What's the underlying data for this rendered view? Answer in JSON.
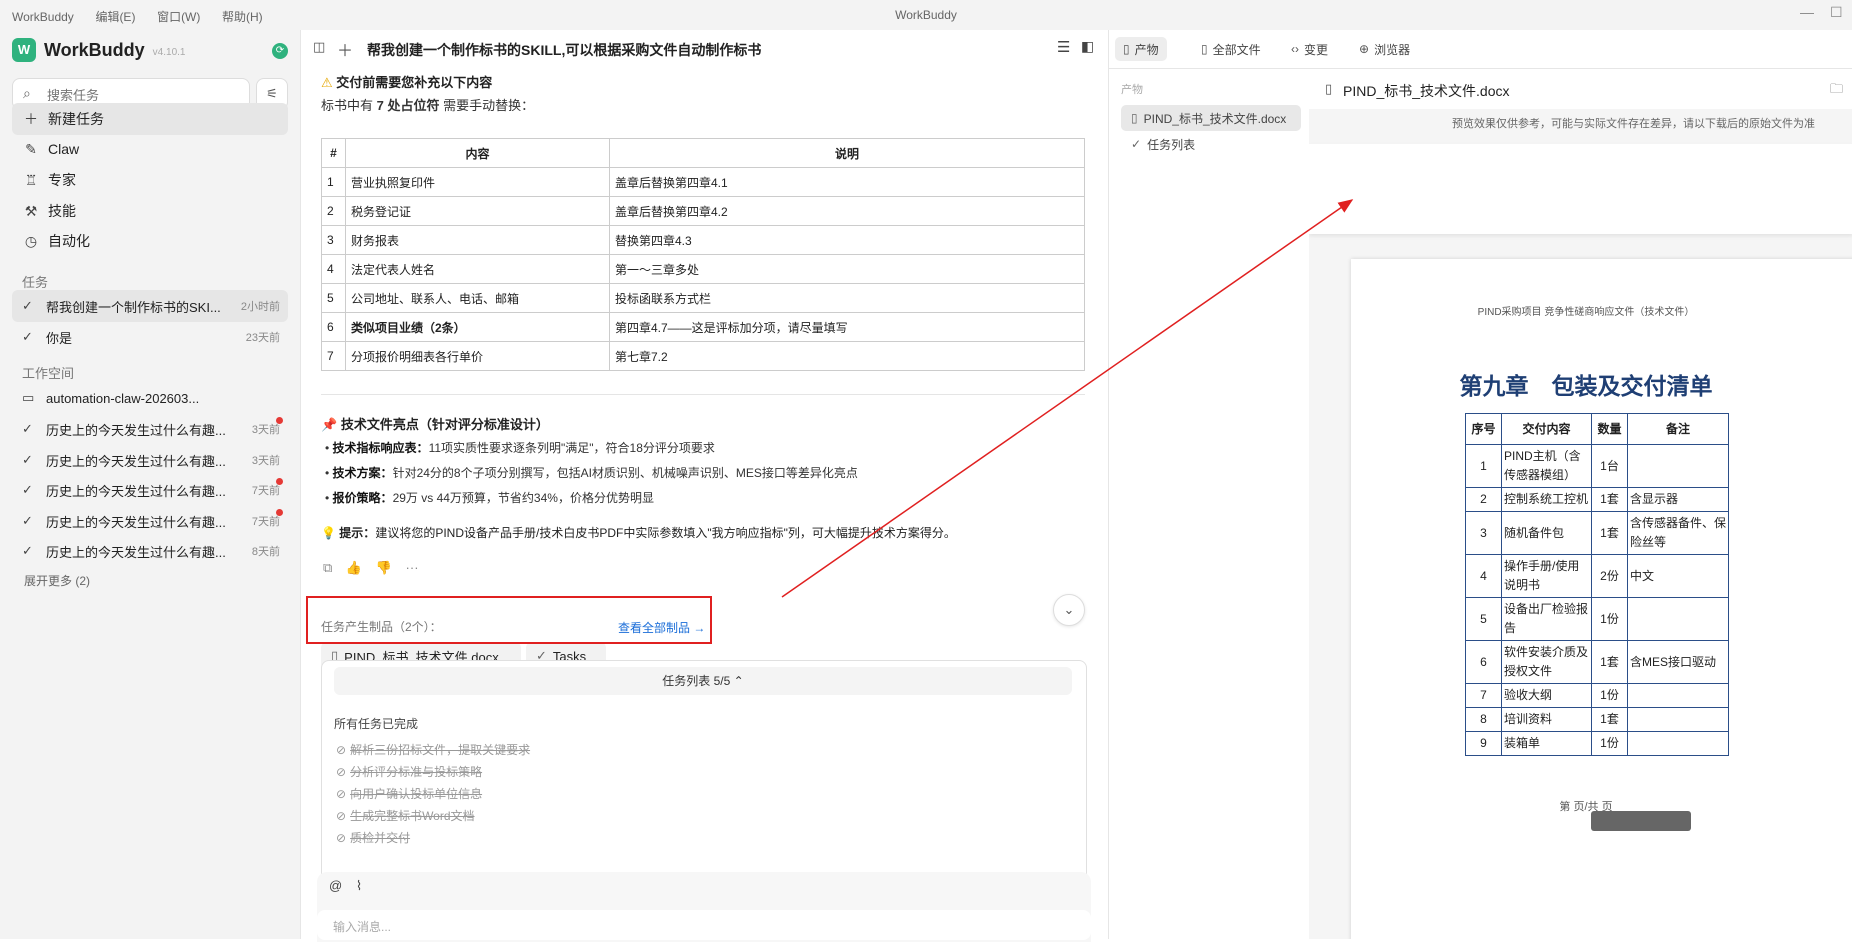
{
  "titlebar": {
    "menu": [
      "WorkBuddy",
      "编辑(E)",
      "窗口(W)",
      "帮助(H)"
    ],
    "title": "WorkBuddy",
    "minimize": "—",
    "maximize": "☐"
  },
  "sidebar": {
    "brand": {
      "name": "WorkBuddy",
      "version": "v4.10.1"
    },
    "search_placeholder": "搜索任务",
    "nav": [
      {
        "label": "新建任务",
        "icon": "plus-icon"
      },
      {
        "label": "Claw",
        "icon": "claw-icon"
      },
      {
        "label": "专家",
        "icon": "expert-icon"
      },
      {
        "label": "技能",
        "icon": "skill-icon"
      },
      {
        "label": "自动化",
        "icon": "clock-icon"
      }
    ],
    "tasks_label": "任务",
    "tasks": [
      {
        "title": "帮我创建一个制作标书的SKI...",
        "time": "2小时前"
      },
      {
        "title": "你是",
        "time": "23天前"
      }
    ],
    "workspace_label": "工作空间",
    "workspace": {
      "folder": "automation-claw-202603..."
    },
    "workspace_tasks": [
      {
        "title": "历史上的今天发生过什么有趣...",
        "time": "3天前",
        "unread": true
      },
      {
        "title": "历史上的今天发生过什么有趣...",
        "time": "3天前",
        "unread": false
      },
      {
        "title": "历史上的今天发生过什么有趣...",
        "time": "7天前",
        "unread": true
      },
      {
        "title": "历史上的今天发生过什么有趣...",
        "time": "7天前",
        "unread": true
      },
      {
        "title": "历史上的今天发生过什么有趣...",
        "time": "8天前",
        "unread": false
      }
    ],
    "expand_more": "展开更多 (2)"
  },
  "chat": {
    "title": "帮我创建一个制作标书的SKILL,可以根据采购文件自动制作标书",
    "warning_title": "交付前需要您补充以下内容",
    "placeholder_line": {
      "prefix": "标书中有 ",
      "count": "7 处占位符",
      "suffix": " 需要手动替换："
    },
    "table": {
      "headers": [
        "#",
        "内容",
        "说明"
      ],
      "rows": [
        [
          "1",
          "营业执照复印件",
          "盖章后替换第四章4.1"
        ],
        [
          "2",
          "税务登记证",
          "盖章后替换第四章4.2"
        ],
        [
          "3",
          "财务报表",
          "替换第四章4.3"
        ],
        [
          "4",
          "法定代表人姓名",
          "第一～三章多处"
        ],
        [
          "5",
          "公司地址、联系人、电话、邮箱",
          "投标函联系方式栏"
        ],
        [
          "6",
          "类似项目业绩（2条）",
          "第四章4.7——这是评标加分项，请尽量填写"
        ],
        [
          "7",
          "分项报价明细表各行单价",
          "第七章7.2"
        ]
      ]
    },
    "highlights_title": "技术文件亮点（针对评分标准设计）",
    "highlights": [
      {
        "key": "技术指标响应表：",
        "text": "11项实质性要求逐条列明\"满足\"，符合18分评分项要求"
      },
      {
        "key": "技术方案：",
        "text": "针对24分的8个子项分别撰写，包括AI材质识别、机械噪声识别、MES接口等差异化亮点"
      },
      {
        "key": "报价策略：",
        "text": "29万 vs 44万预算，节省约34%，价格分优势明显"
      }
    ],
    "tip": {
      "key": "提示：",
      "text": "建议将您的PIND设备产品手册/技术白皮书PDF中实际参数填入\"我方响应指标\"列，可大幅提升技术方案得分。"
    },
    "artifacts_label": "任务产生制品（2个）：",
    "artifacts": [
      "PIND_标书_技术文件.docx",
      "Tasks"
    ],
    "view_all": "查看全部制品 →",
    "tasklist": {
      "header": "任务列表 5/5",
      "status": "所有任务已完成",
      "items": [
        "解析三份招标文件，提取关键要求",
        "分析评分标准与投标策略",
        "向用户确认投标单位信息",
        "生成完整标书Word文档",
        "质检并交付"
      ]
    },
    "composer_placeholder": "输入消息..."
  },
  "right": {
    "tabs": [
      {
        "label": "产物",
        "icon": "doc-icon"
      },
      {
        "label": "全部文件",
        "icon": "file-icon"
      },
      {
        "label": "变更",
        "icon": "code-icon"
      },
      {
        "label": "浏览器",
        "icon": "globe-icon"
      }
    ],
    "artifacts_label": "产物",
    "artifacts": [
      "PIND_标书_技术文件.docx",
      "任务列表"
    ],
    "preview": {
      "filename": "PIND_标书_技术文件.docx",
      "notice": "预览效果仅供参考，可能与实际文件存在差异，请以下载后的原始文件为准",
      "doc_header": "PIND采购项目 竞争性磋商响应文件（技术文件）",
      "chapter": "第九章　包装及交付清单",
      "table_headers": [
        "序号",
        "交付内容",
        "数量",
        "备注"
      ],
      "rows": [
        [
          "1",
          "PIND主机（含传感器模组）",
          "1台",
          ""
        ],
        [
          "2",
          "控制系统工控机",
          "1套",
          "含显示器"
        ],
        [
          "3",
          "随机备件包",
          "1套",
          "含传感器备件、保险丝等"
        ],
        [
          "4",
          "操作手册/使用说明书",
          "2份",
          "中文"
        ],
        [
          "5",
          "设备出厂检验报告",
          "1份",
          ""
        ],
        [
          "6",
          "软件安装介质及授权文件",
          "1套",
          "含MES接口驱动"
        ],
        [
          "7",
          "验收大纲",
          "1份",
          ""
        ],
        [
          "8",
          "培训资料",
          "1套",
          ""
        ],
        [
          "9",
          "装箱单",
          "1份",
          ""
        ]
      ],
      "page_number": "第 页/共 页"
    }
  },
  "colors": {
    "accent": "#2fb27e",
    "link": "#1a6dd8",
    "highlight_box": "#e02020",
    "doc_title": "#1f3f74"
  }
}
